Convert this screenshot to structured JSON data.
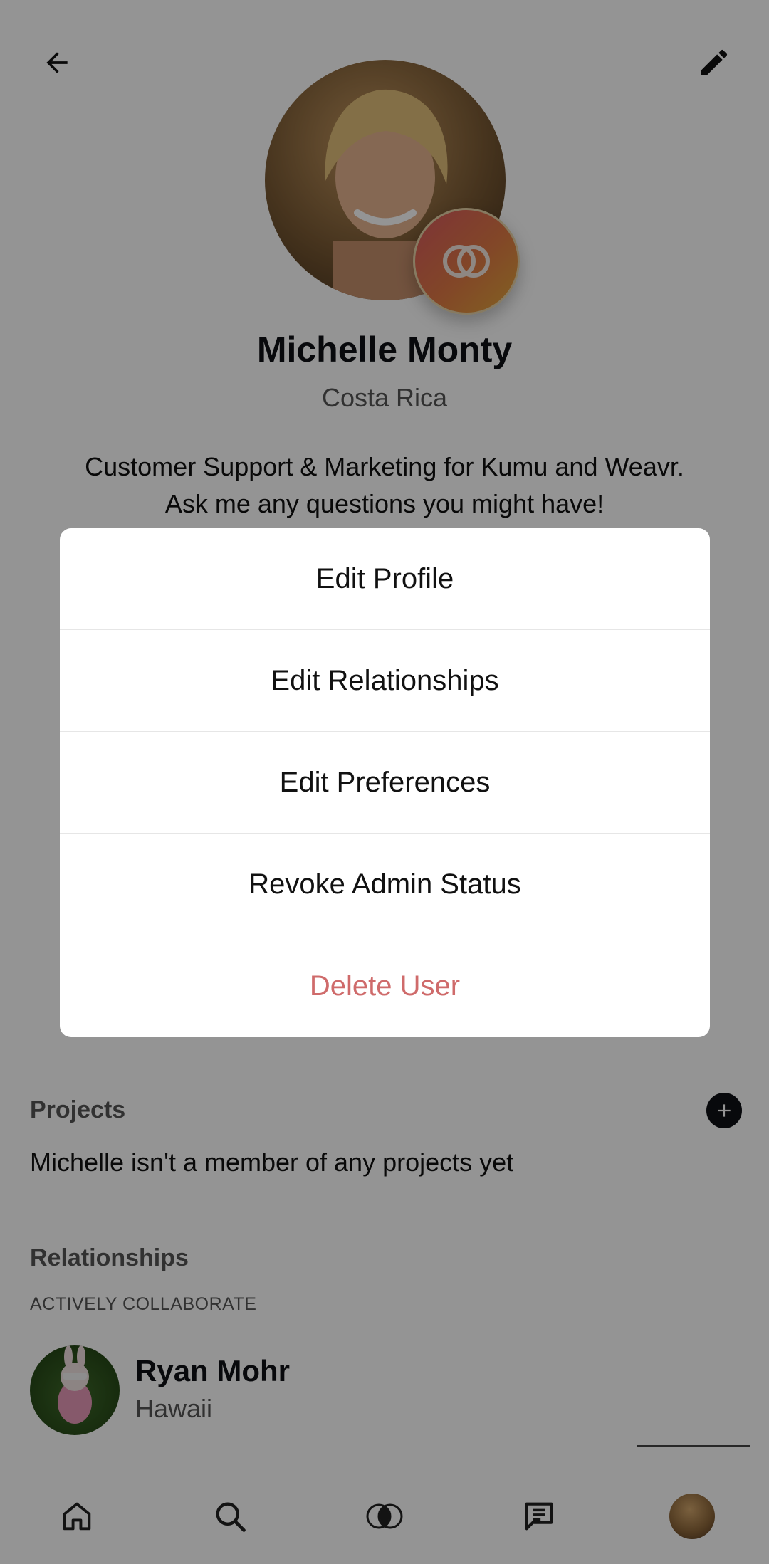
{
  "header": {
    "back_icon": "arrow-left-icon",
    "edit_icon": "pencil-icon"
  },
  "profile": {
    "name": "Michelle Monty",
    "location": "Costa Rica",
    "bio_line1": "Customer Support & Marketing for Kumu and Weavr.",
    "bio_line2": "Ask me any questions you might have!",
    "badge_icon": "weavr-rings-icon",
    "badge_colors": [
      "#d8595f",
      "#e0a83a"
    ]
  },
  "projects": {
    "title": "Projects",
    "empty_text": "Michelle isn't a member of any projects yet",
    "add_icon": "plus-icon"
  },
  "relationships": {
    "title": "Relationships",
    "subtitle": "ACTIVELY COLLABORATE",
    "items": [
      {
        "name": "Ryan Mohr",
        "location": "Hawaii"
      }
    ]
  },
  "action_sheet": {
    "items": [
      {
        "label": "Edit Profile"
      },
      {
        "label": "Edit Relationships"
      },
      {
        "label": "Edit Preferences"
      },
      {
        "label": "Revoke Admin Status"
      },
      {
        "label": "Delete User",
        "color": "#cf6b6b"
      }
    ]
  },
  "tab_bar": {
    "tabs": [
      "home-icon",
      "search-icon",
      "weavr-rings-icon",
      "messages-icon",
      "profile-avatar"
    ]
  }
}
